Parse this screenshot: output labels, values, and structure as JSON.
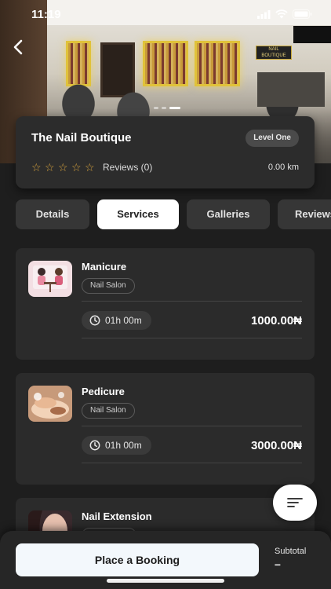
{
  "status_bar": {
    "time": "11:19"
  },
  "salon": {
    "name": "The Nail Boutique",
    "level": "Level One",
    "rating_stars": 0,
    "max_stars": 5,
    "reviews_text": "Reviews (0)",
    "distance": "0.00 km"
  },
  "hero": {
    "sign_text": "NAIL BOUTIQUE",
    "slide_count": 3,
    "active_slide": 2
  },
  "tabs": [
    {
      "label": "Details",
      "active": false
    },
    {
      "label": "Services",
      "active": true
    },
    {
      "label": "Galleries",
      "active": false
    },
    {
      "label": "Reviews",
      "active": false
    }
  ],
  "services": [
    {
      "name": "Manicure",
      "category": "Nail Salon",
      "duration": "01h 00m",
      "price": "1000.00₦",
      "thumb": "manicure"
    },
    {
      "name": "Pedicure",
      "category": "Nail Salon",
      "duration": "01h 00m",
      "price": "3000.00₦",
      "thumb": "pedicure"
    },
    {
      "name": "Nail Extension",
      "category": "",
      "duration": "",
      "price": "",
      "thumb": "nail-extension"
    }
  ],
  "icons": {
    "back": "chevron-left-icon",
    "star": "star-outline-icon",
    "clock": "clock-icon",
    "filter": "filter-lines-icon"
  },
  "colors": {
    "accent_star": "#d9a43f",
    "background": "#1e1e1e",
    "card": "#2b2b2b"
  },
  "bottom_bar": {
    "book_label": "Place a Booking",
    "subtotal_label": "Subtotal",
    "subtotal_value": "–"
  }
}
